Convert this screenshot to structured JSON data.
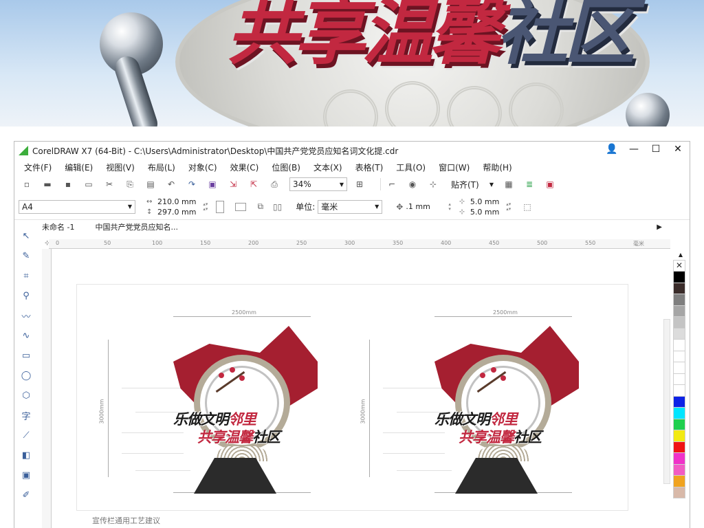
{
  "banner": {
    "title_red": "共享温馨",
    "title_blue": "社区"
  },
  "window": {
    "title": "CorelDRAW X7 (64-Bit) - C:\\Users\\Administrator\\Desktop\\中国共产党党员应知名词文化提.cdr",
    "controls": {
      "minimize": "—",
      "maximize": "☐",
      "close": "✕",
      "user": "👤"
    }
  },
  "menu": [
    "文件(F)",
    "编辑(E)",
    "视图(V)",
    "布局(L)",
    "对象(C)",
    "效果(C)",
    "位图(B)",
    "文本(X)",
    "表格(T)",
    "工具(O)",
    "窗口(W)",
    "帮助(H)"
  ],
  "toolbar": {
    "zoom": "34%",
    "snap": "贴齐(T)"
  },
  "property_bar": {
    "page_size": "A4",
    "width": "210.0 mm",
    "height": "297.0 mm",
    "unit_label": "单位:",
    "unit_value": "毫米",
    "nudge": ".1 mm",
    "dup_x": "5.0 mm",
    "dup_y": "5.0 mm"
  },
  "doc_tabs": [
    "未命名 -1",
    "中国共产党党员应知名..."
  ],
  "ruler_ticks": [
    "0",
    "50",
    "100",
    "150",
    "200",
    "250",
    "300",
    "350",
    "400",
    "450",
    "500",
    "550",
    "毫米"
  ],
  "design": {
    "width_label": "2500mm",
    "height_label": "3000mm",
    "slogan_line1_black": "乐做文明",
    "slogan_line1_red": "邻里",
    "slogan_line2_red": "共享温馨",
    "slogan_line2_black": "社区"
  },
  "footer_text": "宣传栏通用工艺建议",
  "palette": [
    "#000000",
    "#3a2c2a",
    "#7f7f7f",
    "#a6a6a6",
    "#c4c4c4",
    "#dcdcdc",
    "#ffffff",
    "#ffffff",
    "#ffffff",
    "#ffffff",
    "#ffffff",
    "#0d22e6",
    "#00e5ff",
    "#1fcf4e",
    "#f2ea12",
    "#f01313",
    "#f032c9",
    "#f25cc4",
    "#f0a320",
    "#d8b9a9"
  ]
}
